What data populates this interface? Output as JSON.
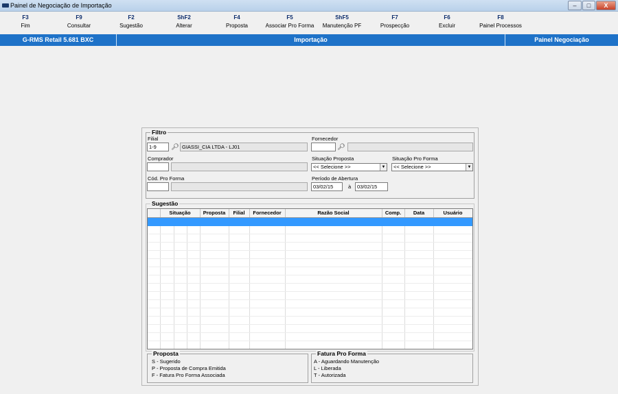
{
  "window": {
    "title": "Painel de Negociação de Importação",
    "buttons": {
      "minimize": "–",
      "maximize": "□",
      "close": "X"
    }
  },
  "fkeys": [
    {
      "key": "F3",
      "label": "Fim"
    },
    {
      "key": "F9",
      "label": "Consultar"
    },
    {
      "key": "F2",
      "label": "Sugestão"
    },
    {
      "key": "ShF2",
      "label": "Alterar"
    },
    {
      "key": "F4",
      "label": "Proposta"
    },
    {
      "key": "F5",
      "label": "Associar Pro Forma"
    },
    {
      "key": "ShF5",
      "label": "Manutenção PF"
    },
    {
      "key": "F7",
      "label": "Prospecção"
    },
    {
      "key": "F6",
      "label": "Excluir"
    },
    {
      "key": "F8",
      "label": "Painel Processos"
    }
  ],
  "statusbar": {
    "system": "G-RMS Retail 5.681 BXC",
    "module": "Importação",
    "screen": "Painel Negociação",
    "color": "#1e72c8"
  },
  "filtro": {
    "legend": "Filtro",
    "filial": {
      "label": "Filial",
      "code": "1-9",
      "name": "GIASSI_CIA LTDA - LJ01"
    },
    "fornecedor": {
      "label": "Fornecedor",
      "code": "",
      "name": ""
    },
    "comprador": {
      "label": "Comprador",
      "code": "",
      "name": ""
    },
    "situacao_proposta": {
      "label": "Situação Proposta",
      "value": "<< Selecione >>"
    },
    "situacao_pro_forma": {
      "label": "Situação Pro Forma",
      "value": "<< Selecione >>"
    },
    "cod_pro_forma": {
      "label": "Cód. Pro Forma",
      "code": "",
      "name": ""
    },
    "periodo": {
      "label": "Período de Abertura",
      "from": "03/02/15",
      "sep": "à",
      "to": "03/02/15"
    }
  },
  "sugestao": {
    "legend": "Sugestão",
    "columns": [
      "",
      "Situação",
      "",
      "Proposta",
      "Filial",
      "Fornecedor",
      "Razão Social",
      "Comp.",
      "Data",
      "Usuário"
    ],
    "selected_color": "#3399ff",
    "row_count": 16
  },
  "proposta_legend": {
    "title": "Proposta",
    "items": [
      "S - Sugerido",
      "P - Proposta de Compra Emitida",
      "F - Fatura Pro Forma Associada"
    ]
  },
  "fatura_legend": {
    "title": "Fatura Pro Forma",
    "items": [
      "A - Aguardando Manutenção",
      "L - Liberada",
      "T - Autorizada"
    ]
  }
}
